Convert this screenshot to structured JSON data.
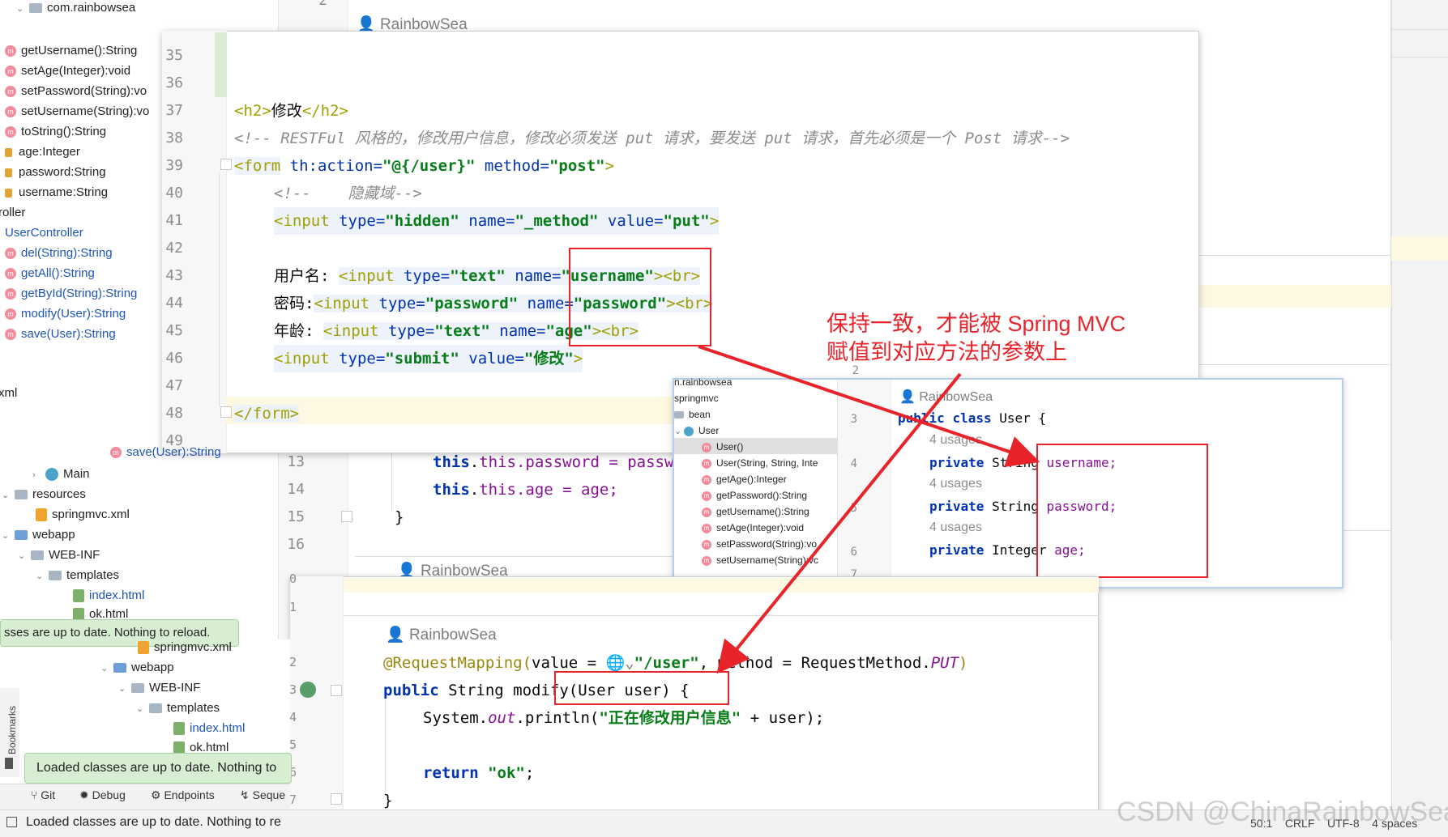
{
  "bg_tree": {
    "items": [
      {
        "label": "com.rainbowsea",
        "icon": "folder-icon"
      },
      {
        "label": "getUsername():String",
        "icon": "method-icon"
      },
      {
        "label": "setAge(Integer):void",
        "icon": "method-icon"
      },
      {
        "label": "setPassword(String):vo",
        "icon": "method-icon"
      },
      {
        "label": "setUsername(String):vo",
        "icon": "method-icon"
      },
      {
        "label": "toString():String",
        "icon": "method-icon"
      },
      {
        "label": "age:Integer",
        "icon": "field-lock-icon"
      },
      {
        "label": "password:String",
        "icon": "field-lock-icon"
      },
      {
        "label": "username:String",
        "icon": "field-lock-icon"
      },
      {
        "label": "roller",
        "icon": ""
      },
      {
        "label": "UserController",
        "icon": "class-icon"
      },
      {
        "label": "del(String):String",
        "icon": "method-icon"
      },
      {
        "label": "getAll():String",
        "icon": "method-icon"
      },
      {
        "label": "getById(String):String",
        "icon": "method-icon"
      },
      {
        "label": "modify(User):String",
        "icon": "method-icon"
      },
      {
        "label": "save(User):String",
        "icon": "method-icon"
      },
      {
        "label": "xml",
        "icon": ""
      },
      {
        "label": "Main",
        "icon": "class-icon"
      },
      {
        "label": "resources",
        "icon": "folder-icon"
      },
      {
        "label": "springmvc.xml",
        "icon": "xml-icon"
      },
      {
        "label": "webapp",
        "icon": "folder-icon"
      },
      {
        "label": "WEB-INF",
        "icon": "folder-icon"
      },
      {
        "label": "templates",
        "icon": "folder-icon"
      },
      {
        "label": "index.html",
        "icon": "html-icon"
      },
      {
        "label": "ok.html",
        "icon": "html-icon"
      }
    ]
  },
  "bg_editor": {
    "lines": [
      "13",
      "14",
      "15",
      "16"
    ],
    "code": [
      "this.password = password;",
      "this.age = age;",
      "}",
      ""
    ],
    "author2": "RainbowSea",
    "author_top": "RainbowSea",
    "top_line": "2"
  },
  "popup1": {
    "line_numbers": [
      "35",
      "36",
      "37",
      "38",
      "39",
      "40",
      "41",
      "42",
      "43",
      "44",
      "45",
      "46",
      "47",
      "48",
      "49"
    ],
    "h2_text": "修改",
    "comment": "<!-- RESTFul 风格的，修改用户信息，修改必须发送 put 请求，要发送 put 请求，首先必须是一个 Post 请求-->",
    "hidden_comment": "<!--    隐藏域-->",
    "labels": {
      "username": "用户名: ",
      "password": "密码:",
      "age": "年龄: "
    },
    "form_action": "\"@{/user}\"",
    "form_method": "\"post\"",
    "submit_value": "\"修改\"",
    "partial_bottom": "save(User):String"
  },
  "popup2": {
    "tree": [
      {
        "label": "n.rainbowsea",
        "icon": ""
      },
      {
        "label": "springmvc",
        "icon": ""
      },
      {
        "label": "bean",
        "icon": "folder-icon"
      },
      {
        "label": "User",
        "icon": "class-icon"
      },
      {
        "label": "User()",
        "icon": "method-icon"
      },
      {
        "label": "User(String, String, Inte",
        "icon": "method-icon"
      },
      {
        "label": "getAge():Integer",
        "icon": "method-icon"
      },
      {
        "label": "getPassword():String",
        "icon": "method-icon"
      },
      {
        "label": "getUsername():String",
        "icon": "method-icon"
      },
      {
        "label": "setAge(Integer):void",
        "icon": "method-icon"
      },
      {
        "label": "setPassword(String):vo",
        "icon": "method-icon"
      },
      {
        "label": "setUsername(String):vc",
        "icon": "method-icon"
      }
    ],
    "line_numbers": [
      "2",
      "3",
      "4",
      "5",
      "6",
      "7"
    ],
    "author": "RainbowSea",
    "usages": [
      "4 usages",
      "4 usages",
      "4 usages"
    ],
    "class_decl": {
      "kw1": "public",
      "kw2": "class",
      "name": "User {"
    },
    "fields": [
      {
        "type": "String",
        "name": "username;"
      },
      {
        "type": "String",
        "name": "password;"
      },
      {
        "type": "Integer",
        "name": "age;"
      }
    ],
    "private_kw": "private"
  },
  "popup3": {
    "line_numbers": [
      "0",
      "1",
      "2",
      "3",
      "4",
      "5",
      "6",
      "7"
    ],
    "author": "RainbowSea",
    "annotation": "@RequestMapping(",
    "value_label": "value = ",
    "value_str": "\"/user\"",
    "method_part": ", method = RequestMethod.",
    "method_const": "PUT",
    "close_paren": ")",
    "sig": {
      "kw": "public",
      "rest": "String modify(User user) {"
    },
    "print": {
      "prefix": "System.",
      "out": "out",
      "mid": ".println(",
      "str": "\"正在修改用户信息\"",
      "suffix": " + user);"
    },
    "ret": {
      "kw": "return",
      "str": "\"ok\"",
      "end": ";"
    },
    "close_brace": "}"
  },
  "bottom_tree": {
    "items": [
      {
        "label": "springmvc.xml",
        "icon": "xml-icon"
      },
      {
        "label": "webapp",
        "icon": "folder-icon"
      },
      {
        "label": "WEB-INF",
        "icon": "folder-icon"
      },
      {
        "label": "templates",
        "icon": "folder-icon"
      },
      {
        "label": "index.html",
        "icon": "html-icon"
      },
      {
        "label": "ok.html",
        "icon": "html-icon"
      }
    ]
  },
  "toasts": {
    "top": "sses are up to date. Nothing to reload.",
    "bottom": "Loaded classes are up to date. Nothing to"
  },
  "tool_strip": {
    "git": "Git",
    "debug": "Debug",
    "endpoints": "Endpoints",
    "sequence": "Seque"
  },
  "status_bar": {
    "message": "Loaded classes are up to date. Nothing to re",
    "position": "50:1",
    "line_sep": "CRLF",
    "encoding": "UTF-8",
    "indent": "4 spaces"
  },
  "bookmarks": "Bookmarks",
  "watermark": "CSDN @ChinaRainbowSea",
  "annotation_note": {
    "line1": "保持一致，才能被 Spring MVC",
    "line2": "赋值到对应方法的参数上"
  },
  "colors": {
    "annotation_red": "#e8232a",
    "keyword": "#0033b3",
    "string": "#067d17",
    "comment": "#8c8c8c"
  }
}
